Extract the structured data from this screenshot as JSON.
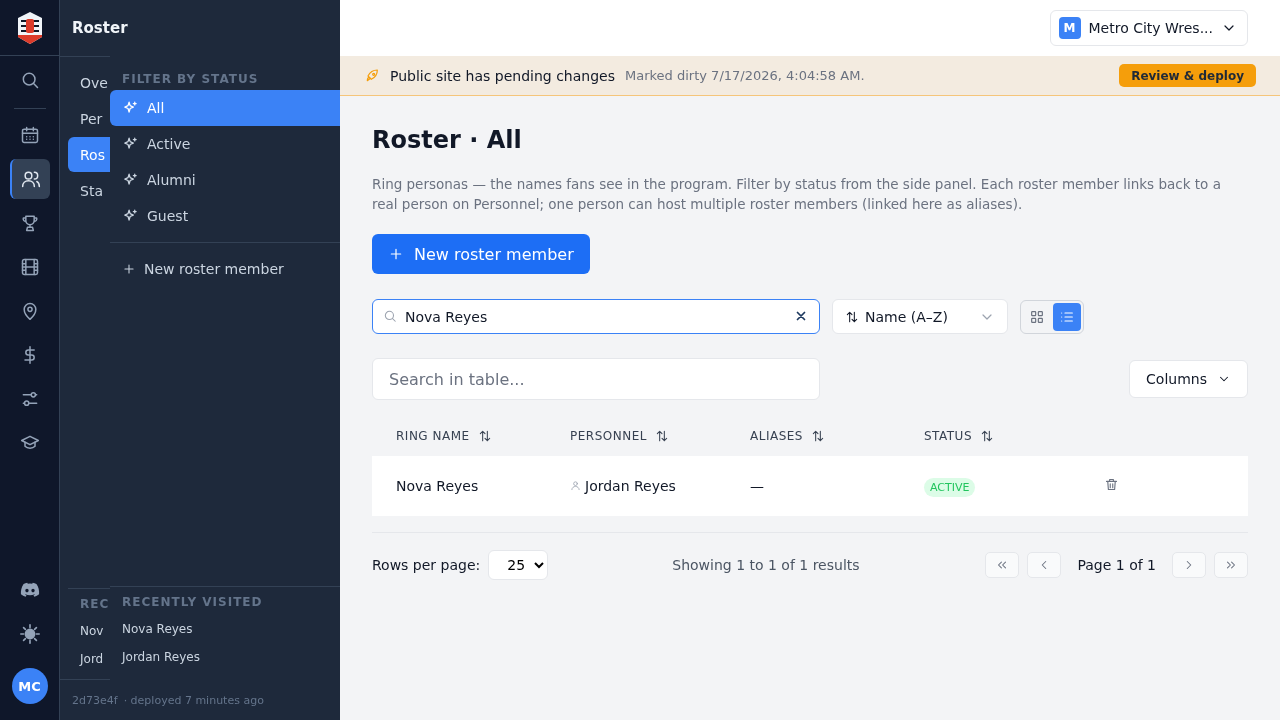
{
  "rail": {
    "items": [
      {
        "kind": "search",
        "selected": false
      },
      {
        "kind": "calendar",
        "selected": false
      },
      {
        "kind": "people",
        "selected": true
      },
      {
        "kind": "trophy",
        "selected": false
      },
      {
        "kind": "film",
        "selected": false
      },
      {
        "kind": "pin",
        "selected": false
      },
      {
        "kind": "dollar",
        "selected": false
      },
      {
        "kind": "sliders",
        "selected": false
      },
      {
        "kind": "cap",
        "selected": false
      }
    ],
    "bottom": [
      {
        "kind": "discord"
      },
      {
        "kind": "sun"
      }
    ],
    "avatar": "MC"
  },
  "sidebar": {
    "title": "Roster",
    "nav": [
      {
        "label": "Ove",
        "selected": false
      },
      {
        "label": "Per",
        "selected": false
      },
      {
        "label": "Ros",
        "selected": true
      },
      {
        "label": "Sta",
        "selected": false
      }
    ],
    "recent_heading": "REC",
    "recent": [
      "Nov",
      "Jord"
    ],
    "commit": "2d73e4f",
    "deployed": "· deployed 7 minutes ago"
  },
  "flyout": {
    "heading": "FILTER BY STATUS",
    "items": [
      {
        "label": "All",
        "selected": true
      },
      {
        "label": "Active",
        "selected": false
      },
      {
        "label": "Alumni",
        "selected": false
      },
      {
        "label": "Guest",
        "selected": false
      }
    ],
    "action": "New roster member",
    "recent_heading": "RECENTLY VISITED",
    "recent": [
      "Nova Reyes",
      "Jordan Reyes"
    ]
  },
  "topbar": {
    "org_initial": "M",
    "org_name": "Metro City Wres..."
  },
  "banner": {
    "title": "Public site has pending changes",
    "detail": "Marked dirty 7/17/2026, 4:04:58 AM.",
    "button": "Review & deploy"
  },
  "page": {
    "title": "Roster · All",
    "description": "Ring personas — the names fans see in the program. Filter by status from the side panel. Each roster member links back to a real person on Personnel; one person can host multiple roster members (linked here as aliases).",
    "new_button": "New roster member"
  },
  "toolbar": {
    "search": "Nova Reyes",
    "sort": "Name (A–Z)",
    "views": [
      {
        "kind": "grid",
        "selected": false
      },
      {
        "kind": "list",
        "selected": true
      }
    ]
  },
  "table": {
    "search_placeholder": "Search in table...",
    "columns_button": "Columns",
    "columns": [
      "RING NAME",
      "PERSONNEL",
      "ALIASES",
      "STATUS"
    ],
    "rows": [
      {
        "ring_name": "Nova Reyes",
        "personnel": "Jordan Reyes",
        "aliases": "—",
        "status": "ACTIVE"
      }
    ]
  },
  "pagination": {
    "rows_label": "Rows per page:",
    "rows_value": "25",
    "showing": "Showing 1 to 1 of 1 results",
    "page": "Page 1 of 1"
  }
}
